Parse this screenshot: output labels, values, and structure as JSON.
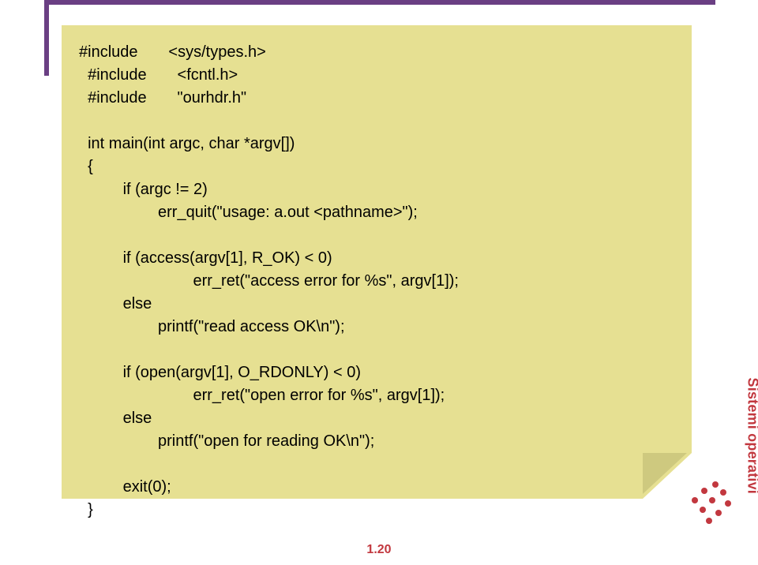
{
  "code": {
    "l01": "#include       <sys/types.h>",
    "l02": "  #include       <fcntl.h>",
    "l03": "  #include       \"ourhdr.h\"",
    "l04": "",
    "l05": "  int main(int argc, char *argv[])",
    "l06": "  {",
    "l07": "          if (argc != 2)",
    "l08": "                  err_quit(\"usage: a.out <pathname>\");",
    "l09": "",
    "l10": "          if (access(argv[1], R_OK) < 0)",
    "l11": "                          err_ret(\"access error for %s\", argv[1]);",
    "l12": "          else",
    "l13": "                  printf(\"read access OK\\n\");",
    "l14": "",
    "l15": "          if (open(argv[1], O_RDONLY) < 0)",
    "l16": "                          err_ret(\"open error for %s\", argv[1]);",
    "l17": "          else",
    "l18": "                  printf(\"open for reading OK\\n\");",
    "l19": "",
    "l20": "          exit(0);",
    "l21": "  }"
  },
  "side_label": "Sistemi operativi",
  "page_number": "1.20"
}
